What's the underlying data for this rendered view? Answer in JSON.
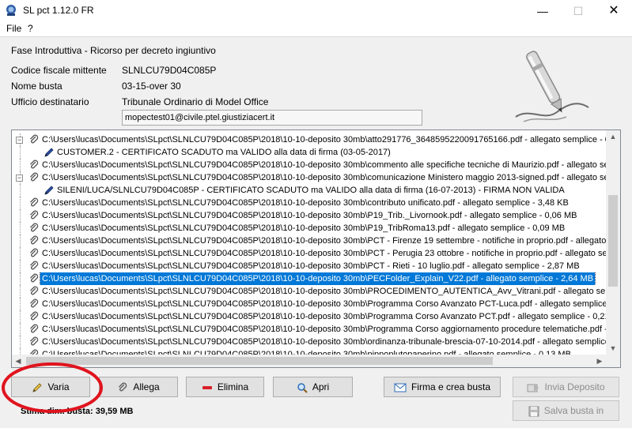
{
  "window": {
    "title": "SL pct 1.12.0 FR",
    "minimize": "—",
    "maximize": "☐",
    "close": "✕"
  },
  "menu": {
    "file": "File",
    "help": "?"
  },
  "header": {
    "phase": "Fase Introduttiva - Ricorso per decreto ingiuntivo",
    "fields": [
      {
        "label": "Codice fiscale mittente",
        "value": "SLNLCU79D04C085P"
      },
      {
        "label": "Nome busta",
        "value": "03-15-over 30"
      },
      {
        "label": "Ufficio destinatario",
        "value": "Tribunale Ordinario di Model Office"
      }
    ],
    "pec": "mopectest01@civile.ptel.giustiziacert.it"
  },
  "files": [
    {
      "text": "C:\\Users\\lucas\\Documents\\SLpct\\SLNLCU79D04C085P\\2018\\10-10-deposito 30mb\\atto291776_3648595220091765166.pdf - allegato semplice - 0,0",
      "type": "file",
      "expander": "−"
    },
    {
      "text": "CUSTOMER.2 - CERTIFICATO SCADUTO ma VALIDO alla data di firma (03-05-2017)",
      "type": "sig"
    },
    {
      "text": "C:\\Users\\lucas\\Documents\\SLpct\\SLNLCU79D04C085P\\2018\\10-10-deposito 30mb\\commento alle specifiche tecniche di Maurizio.pdf - allegato sempli",
      "type": "file"
    },
    {
      "text": "C:\\Users\\lucas\\Documents\\SLpct\\SLNLCU79D04C085P\\2018\\10-10-deposito 30mb\\comunicazione Ministero maggio 2013-signed.pdf - allegato sempli",
      "type": "file",
      "expander": "−"
    },
    {
      "text": "SILENI/LUCA/SLNLCU79D04C085P - CERTIFICATO SCADUTO ma VALIDO alla data di firma (16-07-2013) - FIRMA NON VALIDA",
      "type": "sig"
    },
    {
      "text": "C:\\Users\\lucas\\Documents\\SLpct\\SLNLCU79D04C085P\\2018\\10-10-deposito 30mb\\contributo unificato.pdf - allegato semplice - 3,48 KB",
      "type": "file"
    },
    {
      "text": "C:\\Users\\lucas\\Documents\\SLpct\\SLNLCU79D04C085P\\2018\\10-10-deposito 30mb\\P19_Trib._Livornook.pdf - allegato semplice - 0,06 MB",
      "type": "file"
    },
    {
      "text": "C:\\Users\\lucas\\Documents\\SLpct\\SLNLCU79D04C085P\\2018\\10-10-deposito 30mb\\P19_TribRoma13.pdf - allegato semplice - 0,09 MB",
      "type": "file"
    },
    {
      "text": "C:\\Users\\lucas\\Documents\\SLpct\\SLNLCU79D04C085P\\2018\\10-10-deposito 30mb\\PCT - Firenze 19 settembre - notifiche in proprio.pdf - allegato sem",
      "type": "file"
    },
    {
      "text": "C:\\Users\\lucas\\Documents\\SLpct\\SLNLCU79D04C085P\\2018\\10-10-deposito 30mb\\PCT - Perugia 23 ottobre - notifiche in proprio.pdf - allegato sempl",
      "type": "file"
    },
    {
      "text": "C:\\Users\\lucas\\Documents\\SLpct\\SLNLCU79D04C085P\\2018\\10-10-deposito 30mb\\PCT - Rieti - 10 luglio.pdf - allegato semplice - 2,87 MB",
      "type": "file"
    },
    {
      "text": "C:\\Users\\lucas\\Documents\\SLpct\\SLNLCU79D04C085P\\2018\\10-10-deposito 30mb\\PECFolder_Explain_V22.pdf - allegato semplice - 2,64 MB",
      "type": "file",
      "selected": true
    },
    {
      "text": "C:\\Users\\lucas\\Documents\\SLpct\\SLNLCU79D04C085P\\2018\\10-10-deposito 30mb\\PROCEDIMENTO_AUTENTICA_Avv_Vitrani.pdf - allegato semplice",
      "type": "file"
    },
    {
      "text": "C:\\Users\\lucas\\Documents\\SLpct\\SLNLCU79D04C085P\\2018\\10-10-deposito 30mb\\Programma Corso Avanzato PCT-Luca.pdf - allegato semplice - 0,",
      "type": "file"
    },
    {
      "text": "C:\\Users\\lucas\\Documents\\SLpct\\SLNLCU79D04C085P\\2018\\10-10-deposito 30mb\\Programma Corso Avanzato PCT.pdf - allegato semplice - 0,21 ME",
      "type": "file"
    },
    {
      "text": "C:\\Users\\lucas\\Documents\\SLpct\\SLNLCU79D04C085P\\2018\\10-10-deposito 30mb\\Programma Corso aggiornamento procedure telematiche.pdf - alle",
      "type": "file"
    },
    {
      "text": "C:\\Users\\lucas\\Documents\\SLpct\\SLNLCU79D04C085P\\2018\\10-10-deposito 30mb\\ordinanza-tribunale-brescia-07-10-2014.pdf - allegato semplice - (",
      "type": "file"
    },
    {
      "text": "C:\\Users\\lucas\\Documents\\SLpct\\SLNLCU79D04C085P\\2018\\10-10-deposito 30mb\\pippoplutopaperino.pdf - allegato semplice - 0,13 MB",
      "type": "file"
    }
  ],
  "buttons": {
    "varia": "Varia",
    "allega": "Allega",
    "elimina": "Elimina",
    "apri": "Apri",
    "firma": "Firma e crea busta",
    "invia": "Invia Deposito",
    "salva": "Salva busta in"
  },
  "footer": {
    "stima": "Stima dim. busta: 39,59 MB"
  },
  "colors": {
    "selection": "#0078d7",
    "annotation_ring": "#e0141e",
    "elimina_icon": "#d9202a"
  }
}
